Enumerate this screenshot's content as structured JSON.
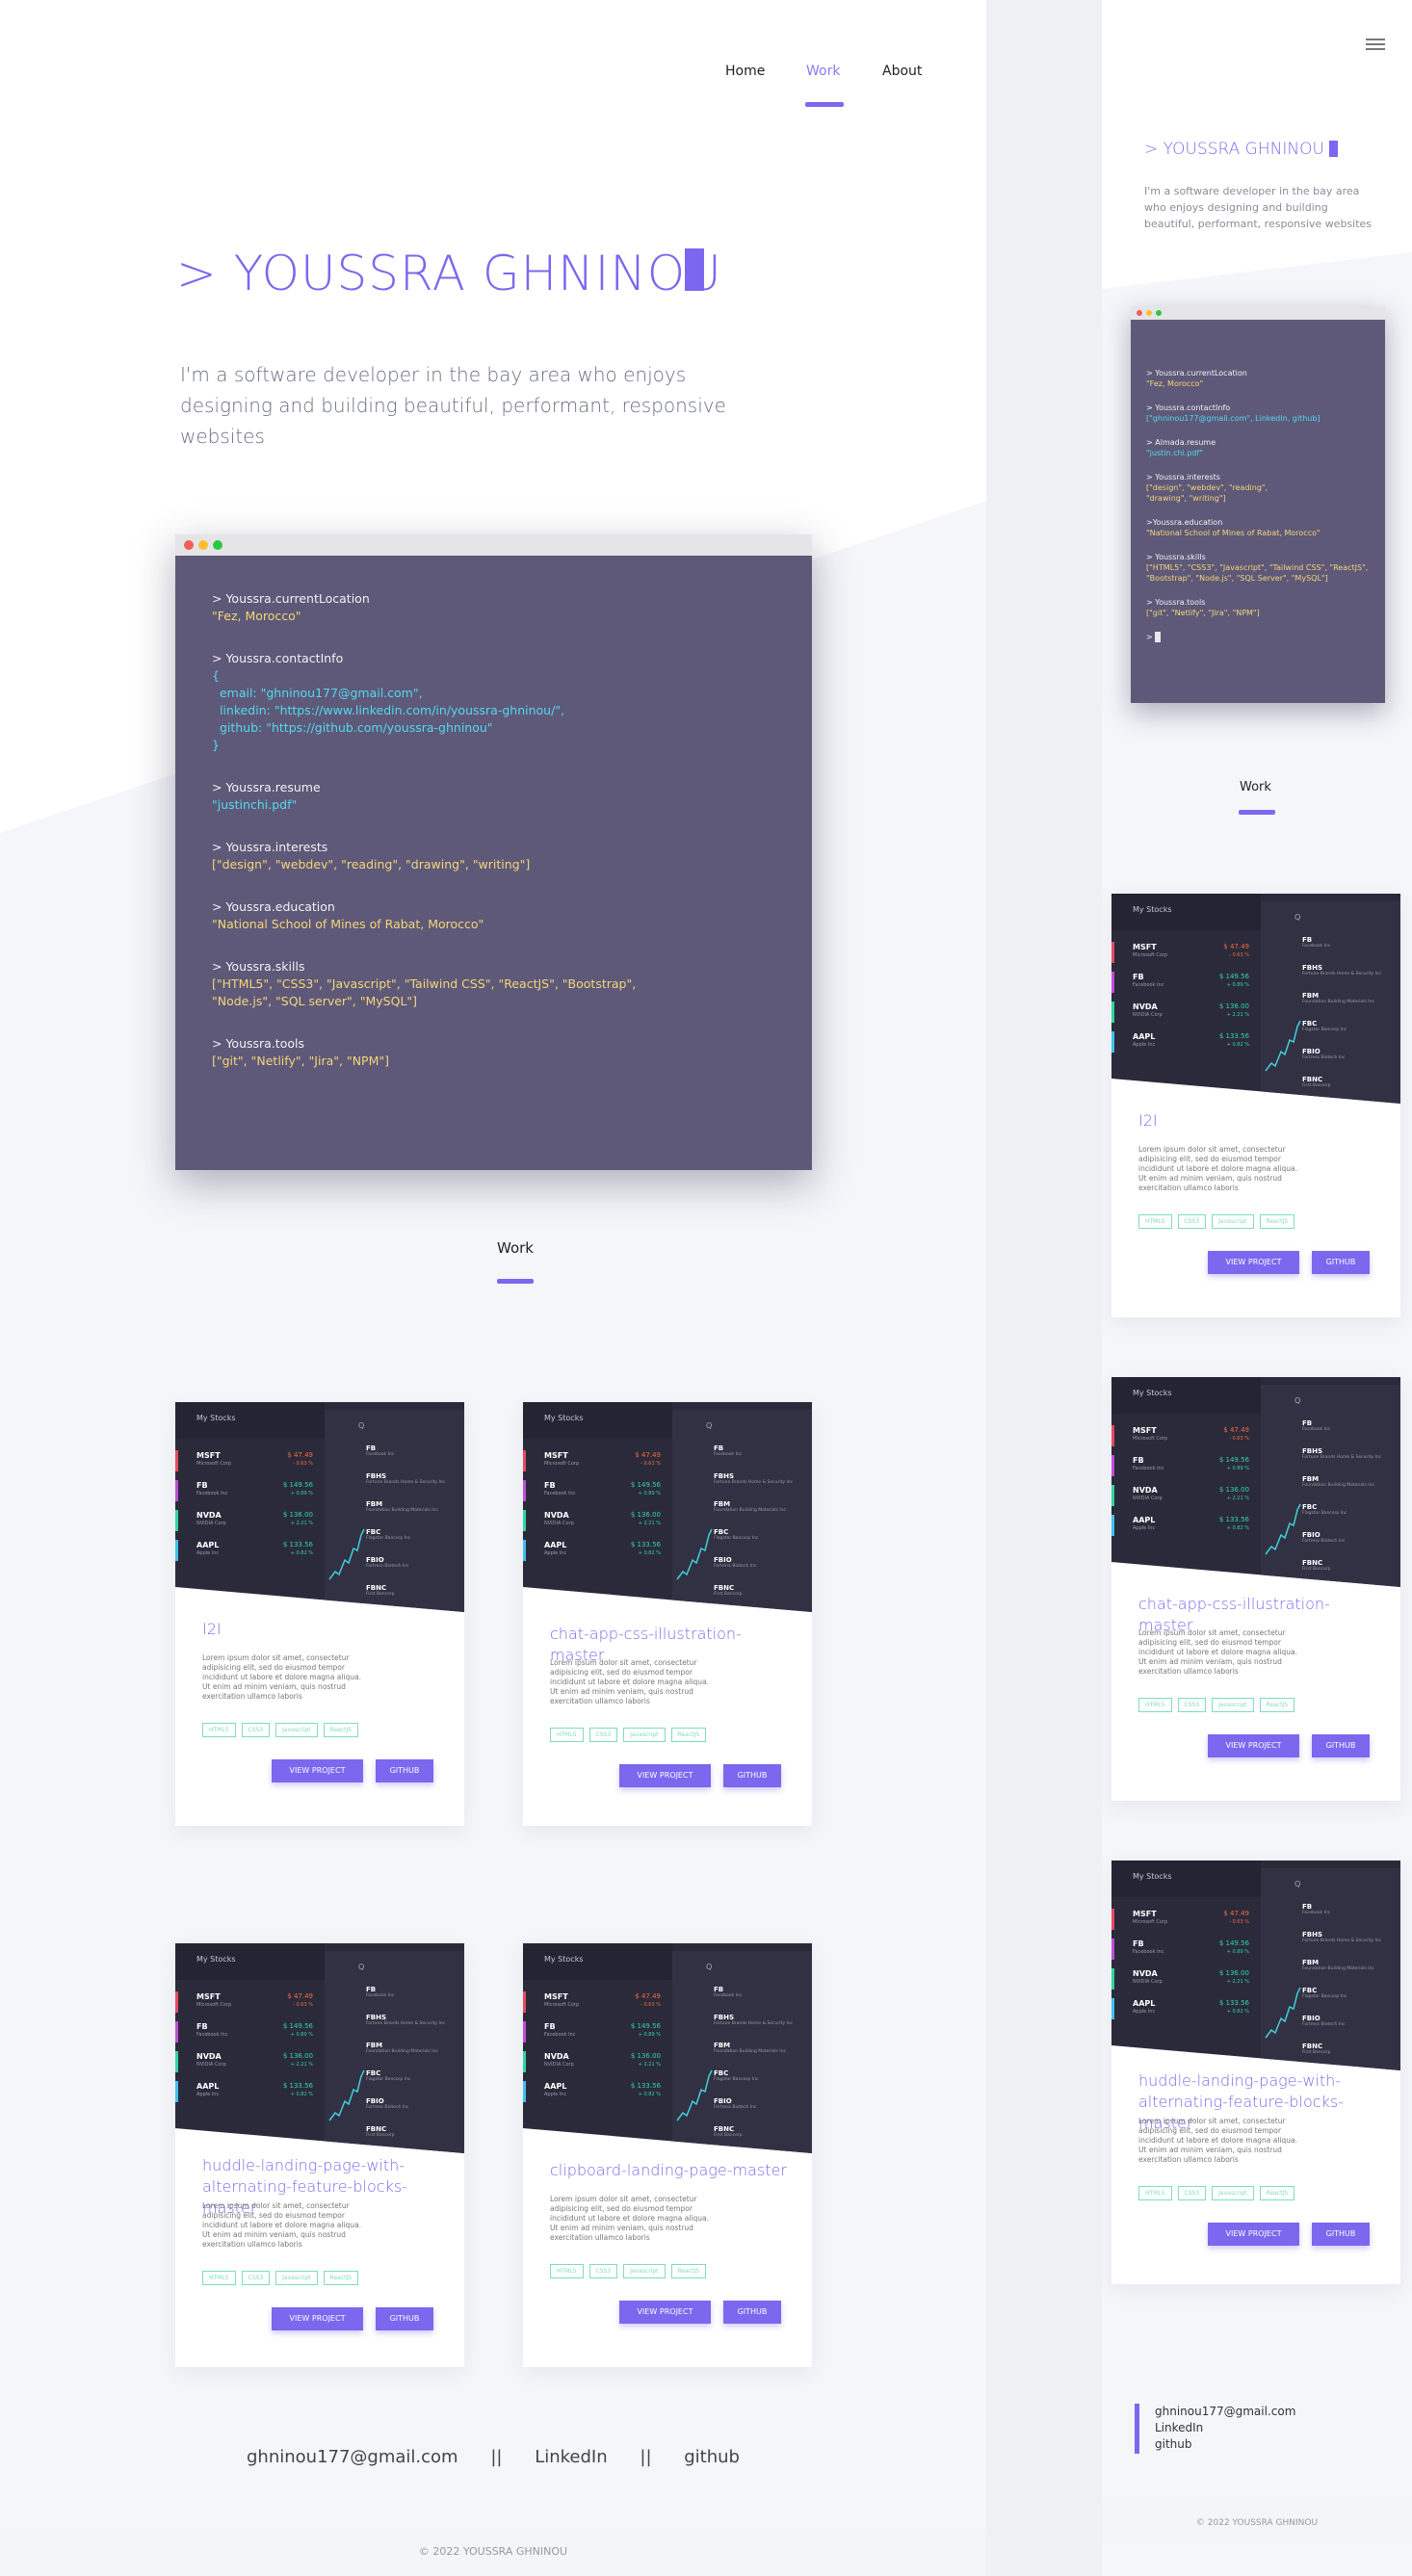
{
  "nav": {
    "home": "Home",
    "work": "Work",
    "about": "About"
  },
  "hero": {
    "title": "> YOUSSRA GHNINOU",
    "subtitle": "I'm a software developer in the bay area who enjoys designing and building beautiful, performant, responsive websites"
  },
  "terminal": {
    "location_cmd": "> Youssra.currentLocation",
    "location_val": "\"Fez, Morocco\"",
    "contact_cmd": "> Youssra.contactInfo",
    "contact_open": "{",
    "email_line": "  email: \"ghninou177@gmail.com\",",
    "linkedin_line": "  linkedin: \"https://www.linkedin.com/in/youssra-ghninou/\",",
    "github_line": "  github: \"https://github.com/youssra-ghninou\"",
    "contact_close": "}",
    "resume_cmd": "> Youssra.resume",
    "resume_val": "\"justinchi.pdf\"",
    "interests_cmd": "> Youssra.interests",
    "interests_val": "[\"design\", \"webdev\", \"reading\", \"drawing\", \"writing\"]",
    "education_cmd": "> Youssra.education",
    "education_val": "\"National School of Mines of Rabat, Morocco\"",
    "skills_cmd": "> Youssra.skills",
    "skills_val1": "[\"HTML5\", \"CSS3\", \"Javascript\", \"Tailwind CSS\", \"ReactJS\", \"Bootstrap\",",
    "skills_val2": "\"Node.js\", \"SQL server\", \"MySQL\"]",
    "tools_cmd": "> Youssra.tools",
    "tools_val": "[\"git\", \"Netlify\", \"Jira\", \"NPM\"]"
  },
  "mobile_terminal": {
    "location_cmd": "> Youssra.currentLocation",
    "location_val": "\"Fez, Morocco\"",
    "contact_cmd": "> Youssra.contactInfo",
    "contact_val": "[\"ghninou177@gmail.com\", LinkedIn, github]",
    "resume_cmd": "> Almada.resume",
    "resume_val": "\"justin.chi.pdf\"",
    "interests_cmd": "> Youssra.interests",
    "interests_val1": "[\"design\", \"webdev\", \"reading\",",
    "interests_val2": "\"drawing\", \"writing\"]",
    "education_cmd": ">Youssra.education",
    "education_val": "\"National School of Mines of Rabat, Morocco\"",
    "skills_cmd": "> Youssra.skills",
    "skills_val1": "[\"HTML5\", \"CSS3\", \"Javascript\", \"Tailwind CSS\", \"ReactJS\",",
    "skills_val2": "\"Bootstrap\", \"Node.js\", \"SQL Server\", \"MySQL\"]",
    "tools_cmd": "> Youssra.tools",
    "tools_val": "[\"git\", \"Netlify\", \"Jira\", \"NPM\"]",
    "prompt": ">"
  },
  "work_heading": "Work",
  "stocks_mock": {
    "header": "My Stocks",
    "search_glyph": "Q",
    "left": [
      {
        "ticker": "MSFT",
        "name": "Microsoft Corp",
        "price": "$ 47.49",
        "change": "- 0.63 %"
      },
      {
        "ticker": "FB",
        "name": "Facebook Inc",
        "price": "$ 149.56",
        "change": "+ 0.89 %"
      },
      {
        "ticker": "NVDA",
        "name": "NVIDIA Corp",
        "price": "$ 136.00",
        "change": "+ 2.21 %"
      },
      {
        "ticker": "AAPL",
        "name": "Apple Inc",
        "price": "$ 133.56",
        "change": "+ 0.82 %"
      }
    ],
    "right": [
      {
        "ticker": "FB",
        "name": "Facebook Inc"
      },
      {
        "ticker": "FBHS",
        "name": "Fortune Brands Home & Security Inc"
      },
      {
        "ticker": "FBM",
        "name": "Foundation Building Materials Inc"
      },
      {
        "ticker": "FBC",
        "name": "Flagstar Bancorp Inc"
      },
      {
        "ticker": "FBIO",
        "name": "Fortress Biotech Inc"
      },
      {
        "ticker": "FBNC",
        "name": "First Bancorp"
      }
    ]
  },
  "projects": [
    {
      "title": "I2I",
      "desc": "Lorem ipsum dolor sit amet, consectetur adipisicing elit, sed do eiusmod tempor incididunt ut labore et dolore magna aliqua. Ut enim ad minim veniam, quis nostrud exercitation ullamco laboris"
    },
    {
      "title": "chat-app-css-illustration-master",
      "desc": "Lorem ipsum dolor sit amet, consectetur adipisicing elit, sed do eiusmod tempor incididunt ut labore et dolore magna aliqua. Ut enim ad minim veniam, quis nostrud exercitation ullamco laboris"
    },
    {
      "title": "huddle-landing-page-with-alternating-feature-blocks-master",
      "desc": "Lorem ipsum dolor sit amet, consectetur adipisicing elit, sed do eiusmod tempor incididunt ut labore et dolore magna aliqua. Ut enim ad minim veniam, quis nostrud exercitation ullamco laboris"
    },
    {
      "title": "clipboard-landing-page-master",
      "desc": "Lorem ipsum dolor sit amet, consectetur adipisicing elit, sed do eiusmod tempor incididunt ut labore et dolore magna aliqua. Ut enim ad minim veniam, quis nostrud exercitation ullamco laboris"
    }
  ],
  "tags": [
    "HTML5",
    "CSS3",
    "Javascript",
    "ReactJS"
  ],
  "buttons": {
    "view": "VIEW PROJECT",
    "github": "GITHUB"
  },
  "footer": {
    "email": "ghninou177@gmail.com",
    "sep": "||",
    "linkedin": "LinkedIn",
    "github": "github",
    "copyright": "© 2022 YOUSSRA GHNINOU"
  },
  "colors": {
    "accent": "#7b68ee",
    "terminal_bg": "#5e5978",
    "terminal_string": "#f3d57a",
    "terminal_link": "#53d8f0",
    "tag": "#7fdcc0",
    "stock_down": "#f26b3a",
    "stock_up": "#2fd6a0"
  }
}
